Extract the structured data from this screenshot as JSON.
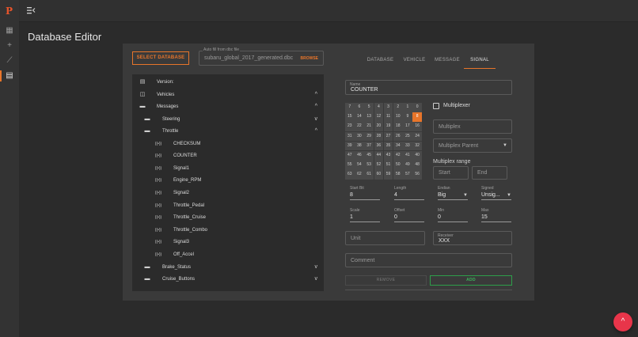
{
  "app": {
    "logo_text": "P",
    "menu_icon": "menu-collapse-icon"
  },
  "rail": {
    "items": [
      {
        "icon": "dashboard-icon",
        "glyph": "▦"
      },
      {
        "icon": "plus-icon",
        "glyph": "+"
      },
      {
        "icon": "chart-icon",
        "glyph": "⟋"
      },
      {
        "icon": "table-icon",
        "glyph": "▤"
      }
    ],
    "active_index": 3
  },
  "page": {
    "title": "Database Editor"
  },
  "database": {
    "select_button": "SELECT DATABASE",
    "file_label": "Auto fill from dbc file",
    "file_value": "subaru_global_2017_generated.dbc",
    "browse_label": "BROWSE"
  },
  "tree": {
    "rows": [
      {
        "label": "Version:",
        "icon": "document-icon",
        "glyph": "▤",
        "indent": 0,
        "chev": ""
      },
      {
        "label": "Vehicles",
        "icon": "vehicle-icon",
        "glyph": "◫",
        "indent": 0,
        "chev": "^"
      },
      {
        "label": "Messages",
        "icon": "messages-icon",
        "glyph": "▬",
        "indent": 0,
        "chev": "^"
      },
      {
        "label": "Steering",
        "icon": "message-icon",
        "glyph": "▬",
        "indent": 1,
        "chev": "v"
      },
      {
        "label": "Throttle",
        "icon": "message-icon",
        "glyph": "▬",
        "indent": 1,
        "chev": "^"
      },
      {
        "label": "CHECKSUM",
        "icon": "signal-icon",
        "glyph": "((•))",
        "indent": 2,
        "chev": ""
      },
      {
        "label": "COUNTER",
        "icon": "signal-icon",
        "glyph": "((•))",
        "indent": 2,
        "chev": ""
      },
      {
        "label": "Signal1",
        "icon": "signal-icon",
        "glyph": "((•))",
        "indent": 2,
        "chev": ""
      },
      {
        "label": "Engine_RPM",
        "icon": "signal-icon",
        "glyph": "((•))",
        "indent": 2,
        "chev": ""
      },
      {
        "label": "Signal2",
        "icon": "signal-icon",
        "glyph": "((•))",
        "indent": 2,
        "chev": ""
      },
      {
        "label": "Throttle_Pedal",
        "icon": "signal-icon",
        "glyph": "((•))",
        "indent": 2,
        "chev": ""
      },
      {
        "label": "Throttle_Cruise",
        "icon": "signal-icon",
        "glyph": "((•))",
        "indent": 2,
        "chev": ""
      },
      {
        "label": "Throttle_Combo",
        "icon": "signal-icon",
        "glyph": "((•))",
        "indent": 2,
        "chev": ""
      },
      {
        "label": "Signal3",
        "icon": "signal-icon",
        "glyph": "((•))",
        "indent": 2,
        "chev": ""
      },
      {
        "label": "Off_Accel",
        "icon": "signal-icon",
        "glyph": "((•))",
        "indent": 2,
        "chev": ""
      },
      {
        "label": "Brake_Status",
        "icon": "message-icon",
        "glyph": "▬",
        "indent": 1,
        "chev": "v"
      },
      {
        "label": "Cruise_Buttons",
        "icon": "message-icon",
        "glyph": "▬",
        "indent": 1,
        "chev": "v"
      }
    ]
  },
  "tabs": [
    {
      "label": "DATABASE",
      "active": false
    },
    {
      "label": "VEHICLE",
      "active": false
    },
    {
      "label": "MESSAGE",
      "active": false
    },
    {
      "label": "SIGNAL",
      "active": true
    }
  ],
  "signal": {
    "name_label": "Name",
    "name_value": "COUNTER",
    "bit_grid": [
      [
        7,
        6,
        5,
        4,
        3,
        2,
        1,
        0
      ],
      [
        15,
        14,
        13,
        12,
        11,
        10,
        9,
        8
      ],
      [
        23,
        22,
        21,
        20,
        19,
        18,
        17,
        16
      ],
      [
        31,
        30,
        29,
        28,
        27,
        26,
        25,
        24
      ],
      [
        39,
        38,
        37,
        36,
        35,
        34,
        33,
        32
      ],
      [
        47,
        46,
        45,
        44,
        43,
        42,
        41,
        40
      ],
      [
        55,
        54,
        53,
        52,
        51,
        50,
        49,
        48
      ],
      [
        63,
        62,
        61,
        60,
        59,
        58,
        57,
        56
      ]
    ],
    "selected_bit": 8,
    "multiplexer_label": "Multiplexer",
    "multiplexer_checked": false,
    "multiplex_placeholder": "Multiplex",
    "multiplex_parent_placeholder": "Multiplex Parent",
    "multiplex_range_label": "Multiplex range",
    "start_placeholder": "Start",
    "end_placeholder": "End",
    "start_bit_label": "Start Bit",
    "start_bit_value": "8",
    "length_label": "Length",
    "length_value": "4",
    "endian_label": "Endian",
    "endian_value": "Big",
    "signed_label": "Signed",
    "signed_value": "Unsig...",
    "scale_label": "Scale",
    "scale_value": "1",
    "offset_label": "Offset",
    "offset_value": "0",
    "min_label": "Min",
    "min_value": "0",
    "max_label": "Max",
    "max_value": "15",
    "unit_placeholder": "Unit",
    "receiver_label": "Receiver",
    "receiver_value": "XXX",
    "comment_placeholder": "Comment",
    "remove_label": "REMOVE",
    "add_label": "ADD"
  },
  "fab": {
    "icon": "chevron-up-icon",
    "glyph": "^"
  },
  "colors": {
    "accent": "#e8752a",
    "add_green": "#3ab55a",
    "fab": "#e8354a"
  }
}
